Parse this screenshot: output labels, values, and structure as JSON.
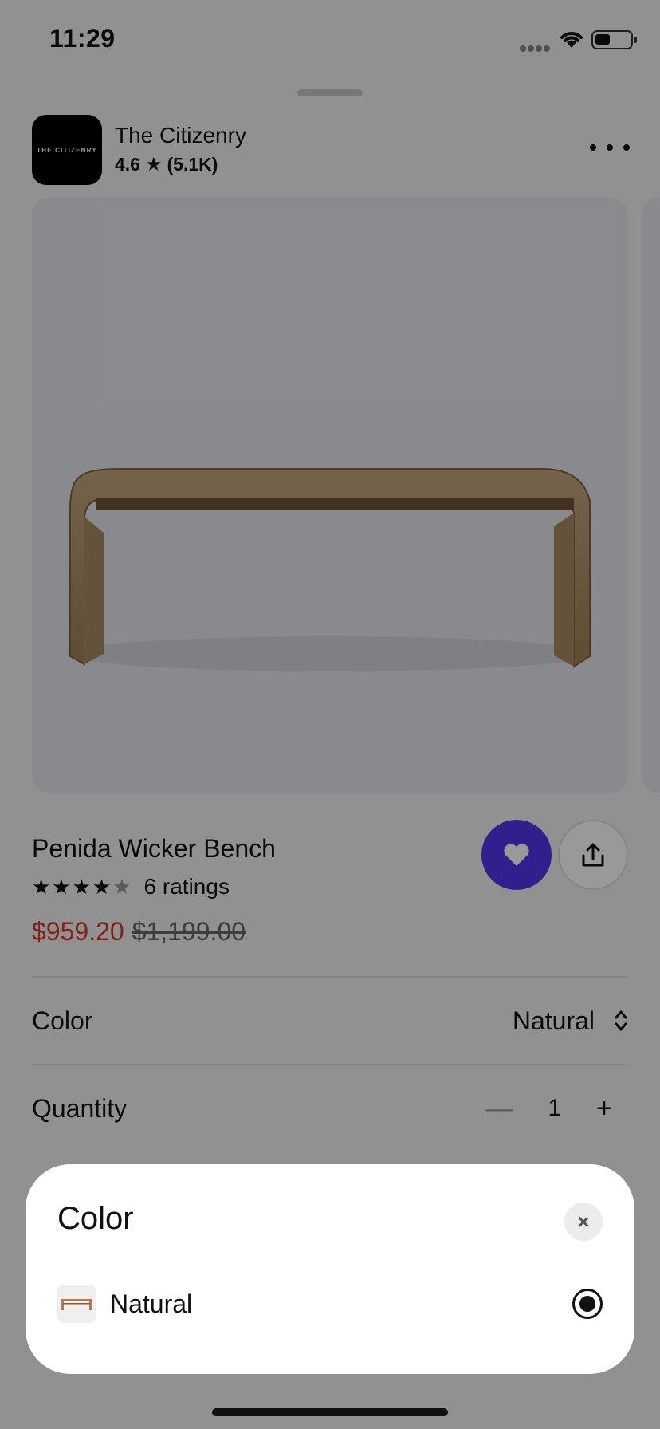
{
  "status_bar": {
    "time": "11:29"
  },
  "store": {
    "logo_text": "THE CITIZENRY",
    "name": "The Citizenry",
    "rating": "4.6",
    "rating_count": "(5.1K)"
  },
  "product": {
    "title": "Penida Wicker Bench",
    "stars": 4.5,
    "ratings_label": "6 ratings",
    "sale_price": "$959.20",
    "original_price": "$1,199.00",
    "favorite_color": "#5433eb",
    "sale_color": "#d63a25"
  },
  "options": {
    "color": {
      "label": "Color",
      "value": "Natural"
    },
    "quantity": {
      "label": "Quantity",
      "minus": "—",
      "value": "1",
      "plus": "+"
    }
  },
  "color_sheet": {
    "title": "Color",
    "close_icon": "×",
    "items": [
      {
        "label": "Natural",
        "selected": true
      }
    ]
  },
  "icons": {
    "more": "ellipsis-icon",
    "favorite": "heart-icon",
    "share": "share-icon",
    "sort": "chevron-up-down-icon",
    "close": "close-icon",
    "star": "★"
  }
}
